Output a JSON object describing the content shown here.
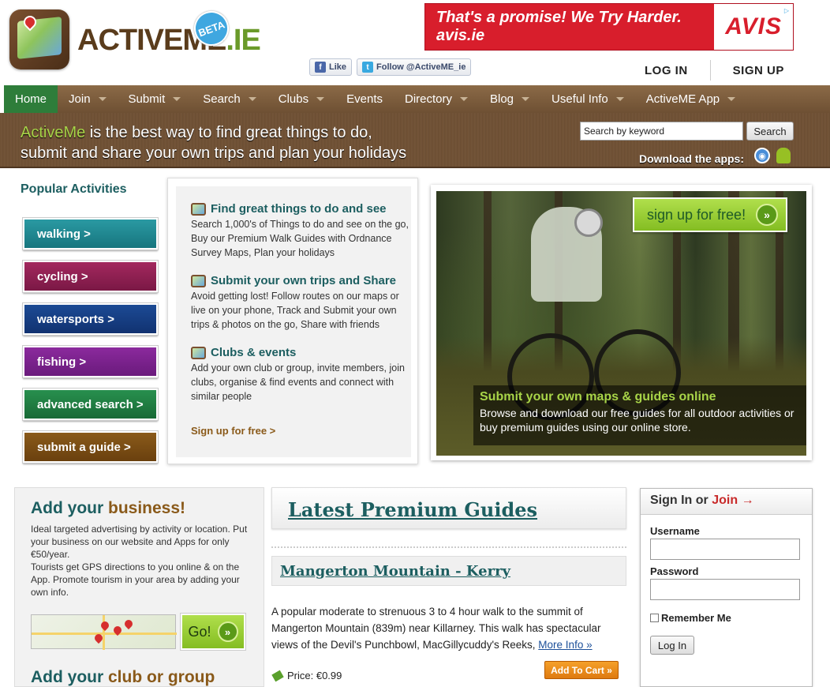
{
  "brand": {
    "name_part1": "ACTIVEME",
    "name_part2": ".IE",
    "beta": "BETA"
  },
  "social": {
    "like_label": "Like",
    "follow_label": "Follow @ActiveME_ie"
  },
  "ad": {
    "slogan": "That's a promise! We Try Harder. avis.ie",
    "logo": "AVIS"
  },
  "auth": {
    "login": "LOG IN",
    "signup": "SIGN UP"
  },
  "nav": {
    "items": [
      {
        "label": "Home",
        "active": true,
        "dropdown": false
      },
      {
        "label": "Join",
        "dropdown": true
      },
      {
        "label": "Submit",
        "dropdown": true
      },
      {
        "label": "Search",
        "dropdown": true
      },
      {
        "label": "Clubs",
        "dropdown": true
      },
      {
        "label": "Events",
        "dropdown": false
      },
      {
        "label": "Directory",
        "dropdown": true
      },
      {
        "label": "Blog",
        "dropdown": true
      },
      {
        "label": "Useful Info",
        "dropdown": true
      },
      {
        "label": "ActiveME App",
        "dropdown": true
      }
    ]
  },
  "banner": {
    "highlight": "ActiveMe",
    "line1_rest": " is the best way to find great things to do,",
    "line2": "submit and share your own trips and plan your holidays",
    "search_placeholder": "Search by keyword",
    "search_button": "Search",
    "apps_label": "Download the apps:"
  },
  "popular": {
    "title": "Popular Activities",
    "items": [
      "walking >",
      "cycling >",
      "watersports >",
      "fishing >",
      "advanced search >",
      "submit a guide >"
    ]
  },
  "features": [
    {
      "title": "Find great things to do and see",
      "body": "Search 1,000's of Things to do and see on the go, Buy our Premium Walk Guides with Ordnance Survey Maps, Plan your holidays"
    },
    {
      "title": "Submit your own trips and Share",
      "body": "Avoid getting lost! Follow routes on our maps or live on your phone, Track and Submit your own trips & photos on the go, Share with friends"
    },
    {
      "title": "Clubs & events",
      "body": "Add your own club or group, invite members, join clubs, organise & find events and connect with similar people"
    }
  ],
  "features_link": "Sign up for free >",
  "hero": {
    "cta": "sign up for free!",
    "caption_title": "Submit your own maps & guides online",
    "caption_body": "Browse and download our free guides for all outdoor activities or buy premium guides using our online store."
  },
  "business": {
    "title_a": "Add your ",
    "title_b": "business!",
    "body1": "Ideal targeted advertising by activity or location. Put your business on our website and Apps for only €50/year.",
    "body2": "Tourists get GPS directions to you online & on the App. Promote tourism in your area by adding your own info.",
    "go": "Go!",
    "title2_a": "Add your ",
    "title2_b": "club or group"
  },
  "premium": {
    "heading": "Latest Premium Guides",
    "guide_title": "Mangerton Mountain - Kerry",
    "guide_desc": "A popular moderate to strenuous 3 to 4 hour walk to the summit of Mangerton Mountain (839m) near Killarney. This walk has spectacular views of the Devil's Punchbowl, MacGillycuddy's Reeks, ",
    "more": "More Info »",
    "price": "Price: €0.99",
    "cart": "Add To Cart »"
  },
  "signin": {
    "title_a": "Sign In or ",
    "title_join": "Join",
    "arrow": "→",
    "username": "Username",
    "password": "Password",
    "remember": "Remember Me",
    "button": "Log In"
  }
}
